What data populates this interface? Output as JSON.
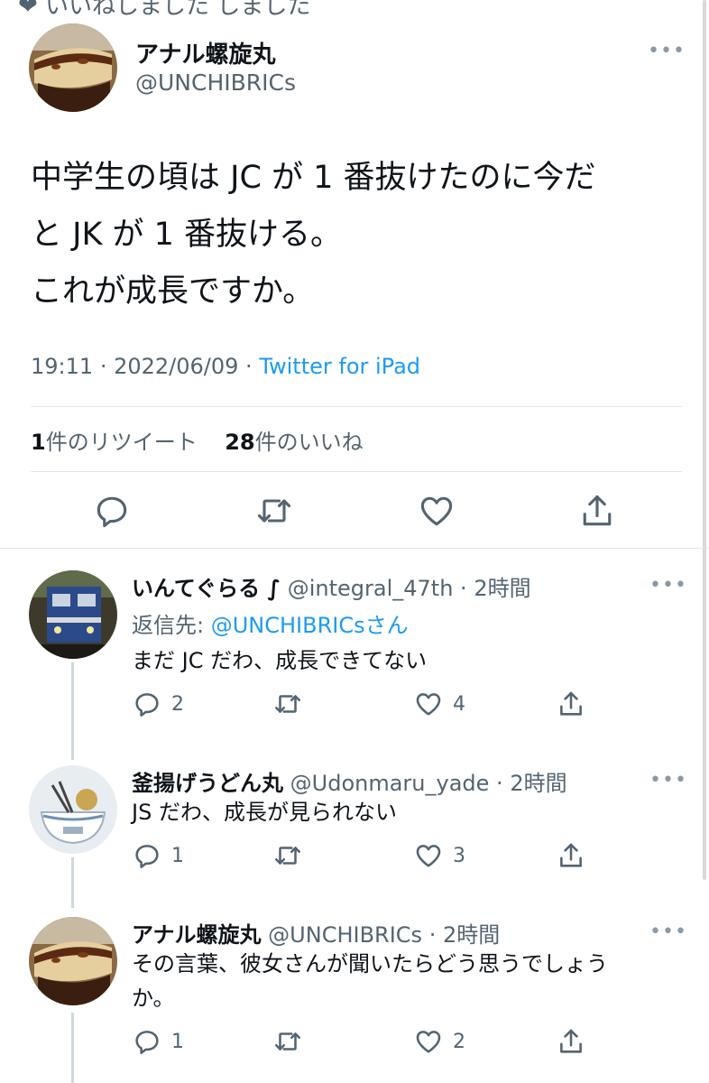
{
  "top_partial": "❤ いいねしました   しました",
  "main_tweet": {
    "name": "アナル螺旋丸",
    "handle": "@UNCHIBRICs",
    "text_lines": [
      "中学生の頃は JC が 1 番抜けたのに今だ",
      "と JK が 1 番抜ける。",
      "これが成長ですか。"
    ],
    "time": "19:11",
    "date": "2022/06/09",
    "source": "Twitter for iPad",
    "retweet_count": "1",
    "retweet_label": "件のリツイート",
    "like_count": "28",
    "like_label": "件のいいね",
    "more": "•••"
  },
  "replies": [
    {
      "name": "いんてぐらる ∫",
      "handle": "@integral_47th",
      "time": "2時間",
      "reply_to_label": "返信先:",
      "reply_to_mention": "@UNCHIBRICsさん",
      "text_lines": [
        "まだ JC だわ、成長できてない"
      ],
      "replies": "2",
      "retweets": "",
      "likes": "4"
    },
    {
      "name": "釜揚げうどん丸",
      "handle": "@Udonmaru_yade",
      "time": "2時間",
      "text_lines": [
        "JS だわ、成長が見られない"
      ],
      "replies": "1",
      "retweets": "",
      "likes": "3"
    },
    {
      "name": "アナル螺旋丸",
      "handle": "@UNCHIBRICs",
      "time": "2時間",
      "text_lines": [
        "その言葉、彼女さんが聞いたらどう思うでしょう",
        "か。"
      ],
      "replies": "1",
      "retweets": "",
      "likes": "2"
    }
  ],
  "icons": [
    "reply-icon",
    "retweet-icon",
    "like-icon",
    "share-icon",
    "more-icon"
  ],
  "colors": {
    "link": "#1d9bf0",
    "muted": "#536471",
    "text": "#0f1419",
    "divider": "#e1e6ea"
  }
}
